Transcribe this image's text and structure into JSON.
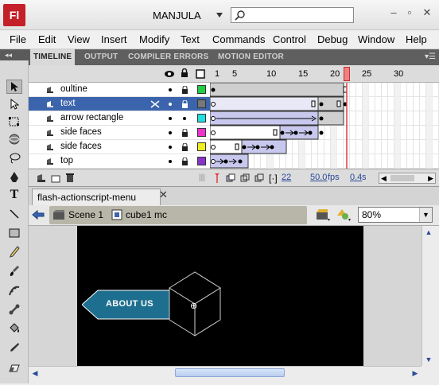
{
  "app": {
    "logo": "Fl",
    "workspace": "MANJULA"
  },
  "search": {
    "placeholder": ""
  },
  "menu": [
    "File",
    "Edit",
    "View",
    "Insert",
    "Modify",
    "Text",
    "Commands",
    "Control",
    "Debug",
    "Window",
    "Help"
  ],
  "panel_tabs": [
    "TIMELINE",
    "OUTPUT",
    "COMPILER ERRORS",
    "MOTION EDITOR"
  ],
  "timeline": {
    "ruler": [
      "1",
      "5",
      "10",
      "15",
      "20",
      "25",
      "30"
    ],
    "layers": [
      {
        "name": "oultine",
        "color": "#22cc44",
        "selected": false
      },
      {
        "name": "text",
        "color": "#777777",
        "selected": true
      },
      {
        "name": "arrow rectangle",
        "color": "#22dddd",
        "selected": false
      },
      {
        "name": "side faces",
        "color": "#ee33cc",
        "selected": false
      },
      {
        "name": "side faces",
        "color": "#eeee22",
        "selected": false
      },
      {
        "name": "top",
        "color": "#8833cc",
        "selected": false
      }
    ],
    "current_frame": "22",
    "fps": "50.0",
    "fps_unit": "fps",
    "time": "0.4",
    "time_unit": "s"
  },
  "document": {
    "tab": "flash-actionscript-menu"
  },
  "editbar": {
    "scene": "Scene 1",
    "symbol": "cube1",
    "symbol_type": "mc",
    "zoom": "80%"
  },
  "stage": {
    "button_text": "ABOUT US",
    "button_color": "#1e6f8f"
  },
  "colors": {
    "selection": "#3b64ad",
    "playhead": "#e23a3a",
    "tween": "#c8c8ee"
  }
}
